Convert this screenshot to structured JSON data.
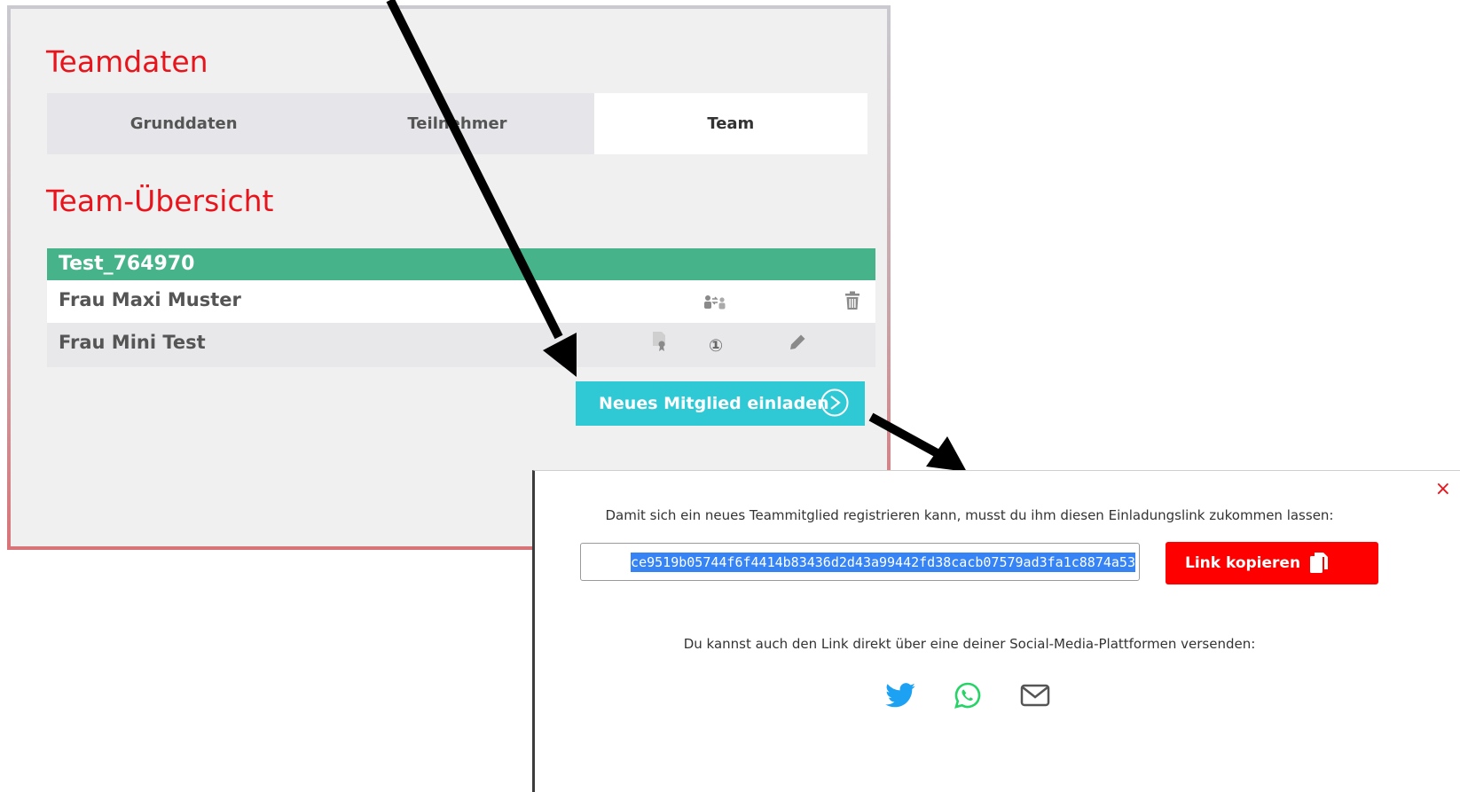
{
  "page": {
    "title": "Teamdaten",
    "tabs": [
      {
        "label": "Grunddaten",
        "active": false
      },
      {
        "label": "Teilnehmer",
        "active": false
      },
      {
        "label": "Team",
        "active": true
      }
    ],
    "section_title": "Team-Übersicht"
  },
  "team": {
    "name": "Test_764970",
    "members": [
      {
        "name": "Frau Maxi Muster",
        "icons": [
          "switch-person-icon",
          "trash-icon"
        ]
      },
      {
        "name": "Frau Mini Test",
        "icons": [
          "certificate-icon",
          "number-one-icon",
          "pencil-icon"
        ]
      }
    ],
    "invite_button": "Neues Mitglied einladen"
  },
  "modal": {
    "message": "Damit sich ein neues Teammitglied registrieren kann, musst du ihm diesen Einladungslink zukommen lassen:",
    "link_value": "ce9519b05744f6f4414b83436d2d43a99442fd38cacb07579ad3fa1c8874a53",
    "copy_button": "Link kopieren",
    "share_message": "Du kannst auch den Link direkt über eine deiner Social-Media-Plattformen versenden:",
    "share_icons": [
      "twitter-icon",
      "whatsapp-icon",
      "mail-icon"
    ],
    "close": "×"
  },
  "colors": {
    "accent_red": "#e8141c",
    "team_green": "#46b38a",
    "invite_cyan": "#2fc9d6",
    "copy_red": "#ff0000",
    "twitter_blue": "#1da1f2",
    "whatsapp_green": "#25d366"
  }
}
